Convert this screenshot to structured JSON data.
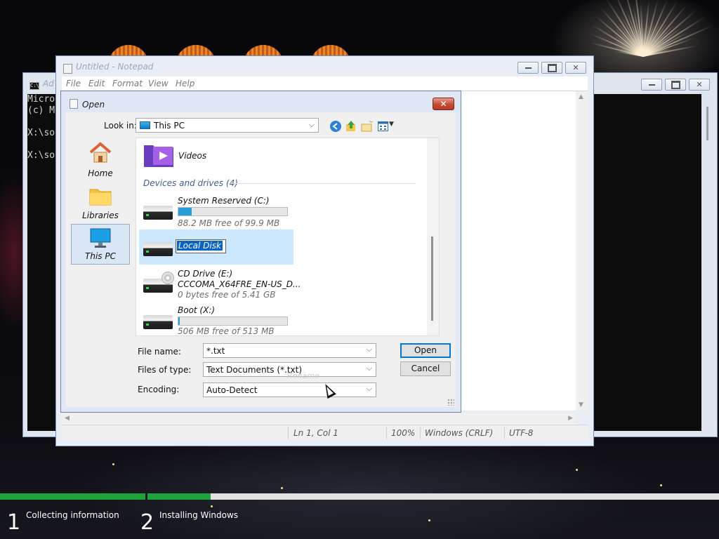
{
  "console": {
    "title": "Ad",
    "lines": "Micro\n(c) M\n\nX:\\so\n\nX:\\so"
  },
  "notepad": {
    "title": "Untitled - Notepad",
    "menu": [
      "File",
      "Edit",
      "Format",
      "View",
      "Help"
    ],
    "status": {
      "position": "Ln 1, Col 1",
      "zoom": "100%",
      "line_ending": "Windows (CRLF)",
      "encoding": "UTF-8"
    }
  },
  "dialog": {
    "title": "Open",
    "close_glyph": "✕",
    "look_in_label": "Look in:",
    "look_in_value": "This PC",
    "places": [
      "Home",
      "Libraries",
      "This PC"
    ],
    "folders": [
      {
        "name": "Videos"
      }
    ],
    "group_header": "Devices and drives (4)",
    "drives": [
      {
        "name": "System Reserved (C:)",
        "free_text": "88.2 MB free of 99.9 MB",
        "used_fraction": 0.12
      },
      {
        "name": "Local Disk",
        "renaming": true
      },
      {
        "name": "CD Drive (E:)",
        "line2": "CCCOMA_X64FRE_EN-US_D...",
        "free_text": "0 bytes free of 5.41 GB"
      },
      {
        "name": "Boot (X:)",
        "free_text": "506 MB free of 513 MB",
        "used_fraction": 0.014
      }
    ],
    "file_name_label": "File name:",
    "file_name_value": "*.txt",
    "files_of_type_label": "Files of type:",
    "files_of_type_value": "Text Documents (*.txt)",
    "encoding_label": "Encoding:",
    "encoding_value": "Auto-Detect",
    "open_button": "Open",
    "cancel_button": "Cancel",
    "ghost_text": "Rename"
  },
  "setup": {
    "steps": [
      {
        "number": "1",
        "label": "Collecting information",
        "progress": 1.0
      },
      {
        "number": "2",
        "label": "Installing Windows",
        "progress": 0.11
      }
    ]
  },
  "colors": {
    "accent": "#0078d7",
    "progress_green": "#1fa33a",
    "drive_bar": "#26a0da",
    "selection": "#cce8ff"
  }
}
